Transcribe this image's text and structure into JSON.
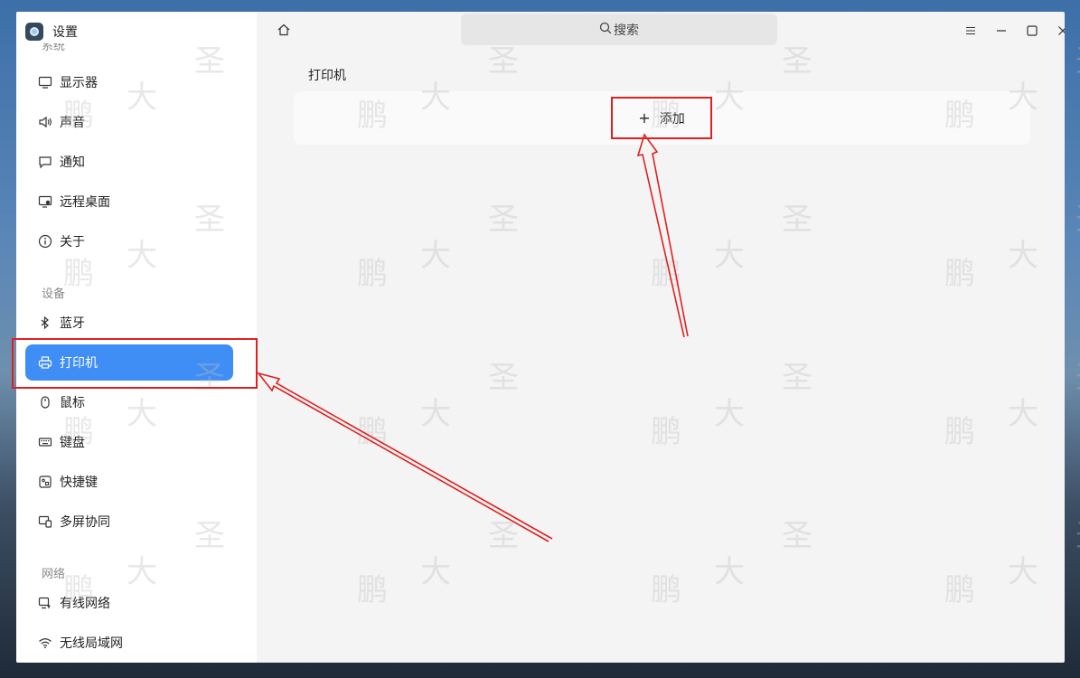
{
  "app": {
    "title": "设置"
  },
  "sidebar": {
    "sections": {
      "system": "系统",
      "devices": "设备",
      "network": "网络"
    },
    "items": [
      {
        "label": "显示器",
        "icon": "monitor-icon"
      },
      {
        "label": "声音",
        "icon": "speaker-icon"
      },
      {
        "label": "通知",
        "icon": "chat-bubble-icon"
      },
      {
        "label": "远程桌面",
        "icon": "remote-desktop-icon"
      },
      {
        "label": "关于",
        "icon": "info-icon"
      },
      {
        "label": "蓝牙",
        "icon": "bluetooth-icon"
      },
      {
        "label": "打印机",
        "icon": "printer-icon",
        "active": true
      },
      {
        "label": "鼠标",
        "icon": "mouse-icon"
      },
      {
        "label": "键盘",
        "icon": "keyboard-icon"
      },
      {
        "label": "快捷键",
        "icon": "shortcut-icon"
      },
      {
        "label": "多屏协同",
        "icon": "multi-screen-icon"
      },
      {
        "label": "有线网络",
        "icon": "wired-network-icon"
      },
      {
        "label": "无线局域网",
        "icon": "wifi-icon"
      }
    ]
  },
  "header": {
    "search_placeholder": "搜索"
  },
  "main": {
    "title": "打印机",
    "add_label": "添加"
  },
  "watermark": {
    "chars": [
      "大",
      "圣",
      "鹏"
    ]
  },
  "colors": {
    "accent": "#3f8ef6",
    "annotation": "#e02020"
  }
}
